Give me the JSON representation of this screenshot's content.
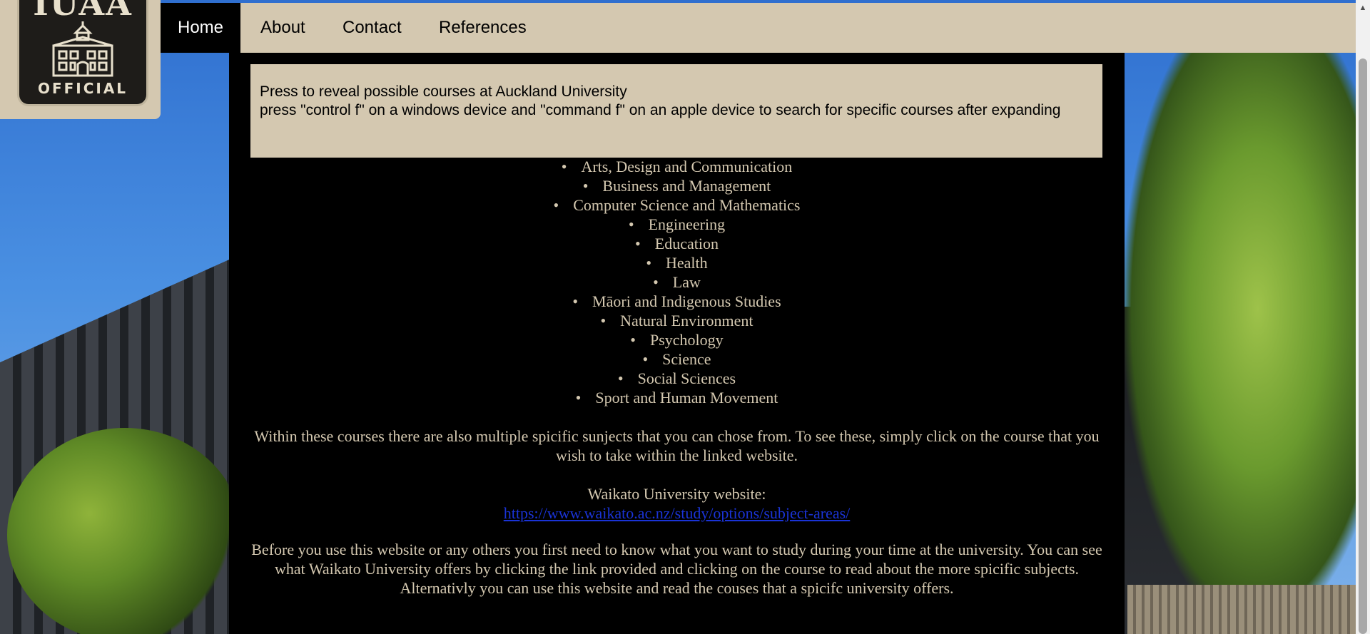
{
  "nav": {
    "items": [
      {
        "label": "Home",
        "active": true
      },
      {
        "label": "About",
        "active": false
      },
      {
        "label": "Contact",
        "active": false
      },
      {
        "label": "References",
        "active": false
      }
    ]
  },
  "logo": {
    "top_text": "IUAA",
    "sub_text": "OFFICIAL"
  },
  "notice": {
    "line1": "Press to reveal possible courses at Auckland University",
    "line2": "press \"control f\" on a windows device and \"command f\" on an apple device to search for specific courses after expanding"
  },
  "courses": [
    "Arts, Design and Communication",
    "Business and Management",
    "Computer Science and Mathematics",
    "Engineering",
    "Education",
    "Health",
    "Law",
    "Māori and Indigenous Studies",
    "Natural Environment",
    "Psychology",
    "Science",
    "Social Sciences",
    "Sport and Human Movement"
  ],
  "content": {
    "courses_note": "Within these courses there are also multiple spicific sunjects that you can chose from. To see these, simply click on the course that you wish to take within the linked website.",
    "website_label": "Waikato University website:",
    "website_url": "https://www.waikato.ac.nz/study/options/subject-areas/",
    "advice": "Before you use this website or any others you first need to know what you want to study during your time at the university. You can see what Waikato University offers by clicking the link provided and clicking on the course to read about the more spicific subjects. Alternativly you can use this website and read the couses that a spicifc university offers."
  },
  "colors": {
    "accent_beige": "#d4c8b0",
    "panel_black": "#000000",
    "link_blue": "#1a33d6"
  }
}
